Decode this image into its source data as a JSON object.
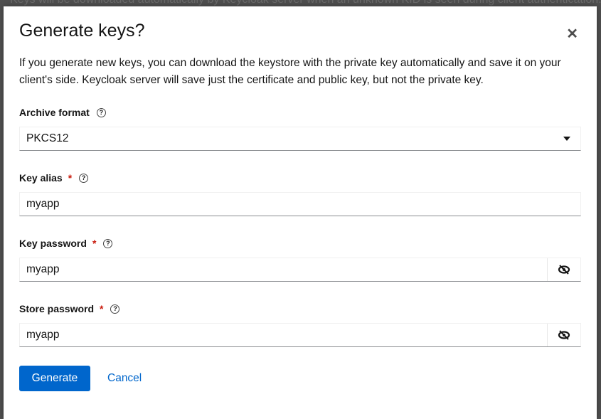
{
  "background": {
    "text": "Keys will be downloaded automatically by Keycloak server when an unknown KID is seen during client authentication."
  },
  "modal": {
    "title": "Generate keys?",
    "close_icon": "close-icon",
    "description": "If you generate new keys, you can download the keystore with the private key automatically and save it on your client's side. Keycloak server will save just the certificate and public key, but not the private key.",
    "archive_format": {
      "label": "Archive format",
      "value": "PKCS12"
    },
    "key_alias": {
      "label": "Key alias",
      "required": "*",
      "value": "myapp"
    },
    "key_password": {
      "label": "Key password",
      "required": "*",
      "value": "myapp"
    },
    "store_password": {
      "label": "Store password",
      "required": "*",
      "value": "myapp"
    },
    "help_icon": "?",
    "generate_label": "Generate",
    "cancel_label": "Cancel",
    "colors": {
      "primary": "#0066cc",
      "required": "#c9190b"
    }
  }
}
